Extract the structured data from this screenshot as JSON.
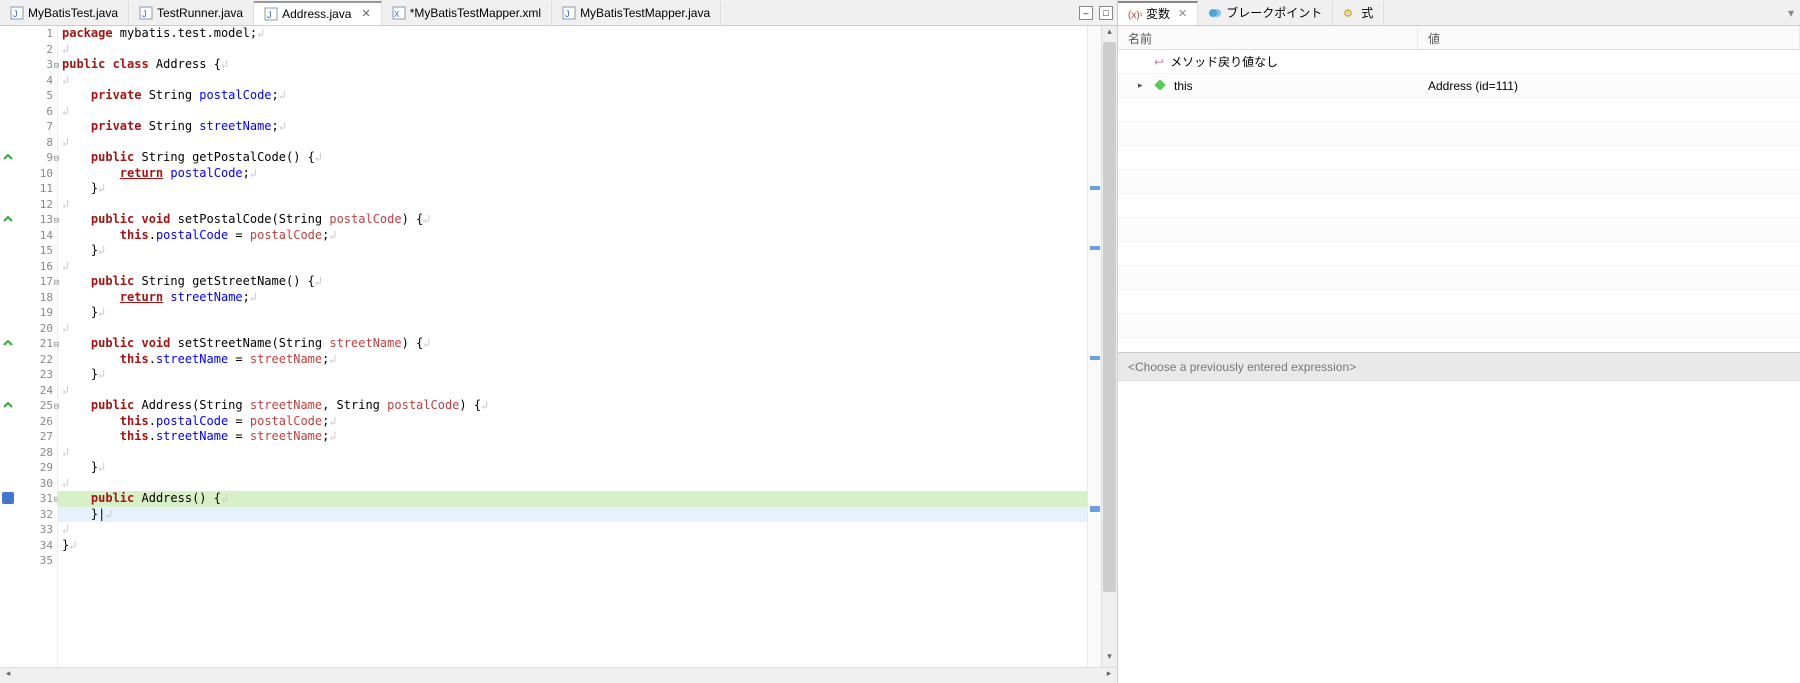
{
  "tabs": [
    {
      "label": "MyBatisTest.java",
      "icon": "java-file-icon"
    },
    {
      "label": "TestRunner.java",
      "icon": "java-file-icon"
    },
    {
      "label": "Address.java",
      "icon": "java-file-icon",
      "active": true
    },
    {
      "label": "*MyBatisTestMapper.xml",
      "icon": "xml-file-icon"
    },
    {
      "label": "MyBatisTestMapper.java",
      "icon": "java-file-icon"
    }
  ],
  "code": {
    "lines": [
      {
        "n": 1,
        "tokens": [
          [
            "kw",
            "package"
          ],
          [
            "plain",
            " mybatis.test.model;"
          ],
          [
            "ws",
            "↲"
          ]
        ]
      },
      {
        "n": 2,
        "tokens": [
          [
            "ws",
            "↲"
          ]
        ]
      },
      {
        "n": 3,
        "fold": "-",
        "tokens": [
          [
            "kw",
            "public class"
          ],
          [
            "plain",
            " Address {"
          ],
          [
            "ws",
            "↲"
          ]
        ]
      },
      {
        "n": 4,
        "tokens": [
          [
            "ws",
            "↲"
          ]
        ]
      },
      {
        "n": 5,
        "tokens": [
          [
            "plain",
            "    "
          ],
          [
            "kw",
            "private"
          ],
          [
            "plain",
            " String "
          ],
          [
            "field",
            "postalCode"
          ],
          [
            "plain",
            ";"
          ],
          [
            "ws",
            "↲"
          ]
        ]
      },
      {
        "n": 6,
        "tokens": [
          [
            "ws",
            "↲"
          ]
        ]
      },
      {
        "n": 7,
        "tokens": [
          [
            "plain",
            "    "
          ],
          [
            "kw",
            "private"
          ],
          [
            "plain",
            " String "
          ],
          [
            "field",
            "streetName"
          ],
          [
            "plain",
            ";"
          ],
          [
            "ws",
            "↲"
          ]
        ]
      },
      {
        "n": 8,
        "tokens": [
          [
            "ws",
            "↲"
          ]
        ]
      },
      {
        "n": 9,
        "fold": "-",
        "marker": "impl",
        "tokens": [
          [
            "plain",
            "    "
          ],
          [
            "kw",
            "public"
          ],
          [
            "plain",
            " String getPostalCode() {"
          ],
          [
            "ws",
            "↲"
          ]
        ]
      },
      {
        "n": 10,
        "tokens": [
          [
            "plain",
            "        "
          ],
          [
            "kw2 underline",
            "return"
          ],
          [
            "plain",
            " "
          ],
          [
            "field",
            "postalCode"
          ],
          [
            "plain",
            ";"
          ],
          [
            "ws",
            "↲"
          ]
        ]
      },
      {
        "n": 11,
        "tokens": [
          [
            "plain",
            "    }"
          ],
          [
            "ws",
            "↲"
          ]
        ]
      },
      {
        "n": 12,
        "tokens": [
          [
            "ws",
            "↲"
          ]
        ]
      },
      {
        "n": 13,
        "fold": "-",
        "marker": "impl",
        "tokens": [
          [
            "plain",
            "    "
          ],
          [
            "kw",
            "public void"
          ],
          [
            "plain",
            " setPostalCode(String "
          ],
          [
            "param",
            "postalCode"
          ],
          [
            "plain",
            ") {"
          ],
          [
            "ws",
            "↲"
          ]
        ]
      },
      {
        "n": 14,
        "tokens": [
          [
            "plain",
            "        "
          ],
          [
            "kw",
            "this"
          ],
          [
            "plain",
            "."
          ],
          [
            "field",
            "postalCode"
          ],
          [
            "plain",
            " = "
          ],
          [
            "param",
            "postalCode"
          ],
          [
            "plain",
            ";"
          ],
          [
            "ws",
            "↲"
          ]
        ]
      },
      {
        "n": 15,
        "tokens": [
          [
            "plain",
            "    }"
          ],
          [
            "ws",
            "↲"
          ]
        ]
      },
      {
        "n": 16,
        "tokens": [
          [
            "ws",
            "↲"
          ]
        ]
      },
      {
        "n": 17,
        "fold": "-",
        "tokens": [
          [
            "plain",
            "    "
          ],
          [
            "kw",
            "public"
          ],
          [
            "plain",
            " String getStreetName() {"
          ],
          [
            "ws",
            "↲"
          ]
        ]
      },
      {
        "n": 18,
        "tokens": [
          [
            "plain",
            "        "
          ],
          [
            "kw2 underline",
            "return"
          ],
          [
            "plain",
            " "
          ],
          [
            "field",
            "streetName"
          ],
          [
            "plain",
            ";"
          ],
          [
            "ws",
            "↲"
          ]
        ]
      },
      {
        "n": 19,
        "tokens": [
          [
            "plain",
            "    }"
          ],
          [
            "ws",
            "↲"
          ]
        ]
      },
      {
        "n": 20,
        "tokens": [
          [
            "ws",
            "↲"
          ]
        ]
      },
      {
        "n": 21,
        "fold": "-",
        "marker": "impl",
        "tokens": [
          [
            "plain",
            "    "
          ],
          [
            "kw",
            "public void"
          ],
          [
            "plain",
            " setStreetName(String "
          ],
          [
            "param",
            "streetName"
          ],
          [
            "plain",
            ") {"
          ],
          [
            "ws",
            "↲"
          ]
        ]
      },
      {
        "n": 22,
        "tokens": [
          [
            "plain",
            "        "
          ],
          [
            "kw",
            "this"
          ],
          [
            "plain",
            "."
          ],
          [
            "field",
            "streetName"
          ],
          [
            "plain",
            " = "
          ],
          [
            "param",
            "streetName"
          ],
          [
            "plain",
            ";"
          ],
          [
            "ws",
            "↲"
          ]
        ]
      },
      {
        "n": 23,
        "tokens": [
          [
            "plain",
            "    }"
          ],
          [
            "ws",
            "↲"
          ]
        ]
      },
      {
        "n": 24,
        "tokens": [
          [
            "ws",
            "↲"
          ]
        ]
      },
      {
        "n": 25,
        "fold": "-",
        "marker": "impl",
        "tokens": [
          [
            "plain",
            "    "
          ],
          [
            "kw",
            "public"
          ],
          [
            "plain",
            " Address(String "
          ],
          [
            "param",
            "streetName"
          ],
          [
            "plain",
            ", String "
          ],
          [
            "param",
            "postalCode"
          ],
          [
            "plain",
            ") {"
          ],
          [
            "ws",
            "↲"
          ]
        ]
      },
      {
        "n": 26,
        "tokens": [
          [
            "plain",
            "        "
          ],
          [
            "kw",
            "this"
          ],
          [
            "plain",
            "."
          ],
          [
            "field",
            "postalCode"
          ],
          [
            "plain",
            " = "
          ],
          [
            "param",
            "postalCode"
          ],
          [
            "plain",
            ";"
          ],
          [
            "ws",
            "↲"
          ]
        ]
      },
      {
        "n": 27,
        "tokens": [
          [
            "plain",
            "        "
          ],
          [
            "kw",
            "this"
          ],
          [
            "plain",
            "."
          ],
          [
            "field",
            "streetName"
          ],
          [
            "plain",
            " = "
          ],
          [
            "param",
            "streetName"
          ],
          [
            "plain",
            ";"
          ],
          [
            "ws",
            "↲"
          ]
        ]
      },
      {
        "n": 28,
        "tokens": [
          [
            "ws",
            "↲"
          ]
        ]
      },
      {
        "n": 29,
        "tokens": [
          [
            "plain",
            "    }"
          ],
          [
            "ws",
            "↲"
          ]
        ]
      },
      {
        "n": 30,
        "tokens": [
          [
            "ws",
            "↲"
          ]
        ]
      },
      {
        "n": 31,
        "fold": "-",
        "hl": "new",
        "marker": "debug",
        "tokens": [
          [
            "plain",
            "    "
          ],
          [
            "kw",
            "public"
          ],
          [
            "plain",
            " Address() {"
          ],
          [
            "ws",
            "↲"
          ]
        ]
      },
      {
        "n": 32,
        "hl": "current",
        "tokens": [
          [
            "plain",
            "    }|"
          ],
          [
            "ws",
            "↲"
          ]
        ]
      },
      {
        "n": 33,
        "tokens": [
          [
            "ws",
            "↲"
          ]
        ]
      },
      {
        "n": 34,
        "tokens": [
          [
            "plain",
            "}"
          ],
          [
            "ws",
            "↲"
          ]
        ]
      },
      {
        "n": 35,
        "tokens": [
          [
            "plain",
            ""
          ]
        ]
      }
    ]
  },
  "views": {
    "tabs": [
      {
        "label": "変数",
        "icon": "variables-icon",
        "active": true
      },
      {
        "label": "ブレークポイント",
        "icon": "breakpoints-icon"
      },
      {
        "label": "式",
        "icon": "expressions-icon"
      }
    ],
    "columns": {
      "name": "名前",
      "value": "値"
    },
    "rows": [
      {
        "kind": "return",
        "name": "メソッド戻り値なし",
        "value": ""
      },
      {
        "kind": "this",
        "name": "this",
        "value": "Address  (id=111)",
        "expandable": true
      }
    ],
    "expression_placeholder": "<Choose a previously entered expression>"
  }
}
